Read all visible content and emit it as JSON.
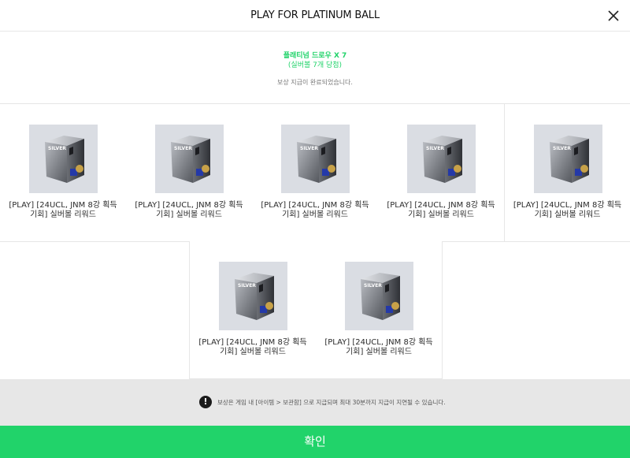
{
  "header": {
    "title": "PLAY FOR PLATINUM BALL",
    "close_icon": "close-icon"
  },
  "summary": {
    "title": "플래티넘 드로우 X 7",
    "subtitle": "(실버볼 7개 당첨)",
    "message": "보상 지급이 완료되었습니다."
  },
  "rewards": [
    {
      "name": "[PLAY] [24UCL, JNM 8강 획득 기회] 실버볼 리워드",
      "box_label": "SILVER"
    },
    {
      "name": "[PLAY] [24UCL, JNM 8강 획득 기회] 실버볼 리워드",
      "box_label": "SILVER"
    },
    {
      "name": "[PLAY] [24UCL, JNM 8강 획득 기회] 실버볼 리워드",
      "box_label": "SILVER"
    },
    {
      "name": "[PLAY] [24UCL, JNM 8강 획득 기회] 실버볼 리워드",
      "box_label": "SILVER"
    },
    {
      "name": "[PLAY] [24UCL, JNM 8강 획득 기회] 실버볼 리워드",
      "box_label": "SILVER"
    },
    {
      "name": "[PLAY] [24UCL, JNM 8강 획득 기회] 실버볼 리워드",
      "box_label": "SILVER"
    },
    {
      "name": "[PLAY] [24UCL, JNM 8강 획득 기회] 실버볼 리워드",
      "box_label": "SILVER"
    }
  ],
  "notice": {
    "icon": "exclamation-icon",
    "icon_glyph": "!",
    "text": "보상은 게임 내 [아이템 > 보관함] 으로 지급되며 최대 30분까지 지급이 지연될 수 있습니다."
  },
  "confirm": {
    "label": "확인"
  },
  "colors": {
    "accent": "#21d36a",
    "notice_bg": "#e7e7e7",
    "item_bg": "#dadde3"
  }
}
